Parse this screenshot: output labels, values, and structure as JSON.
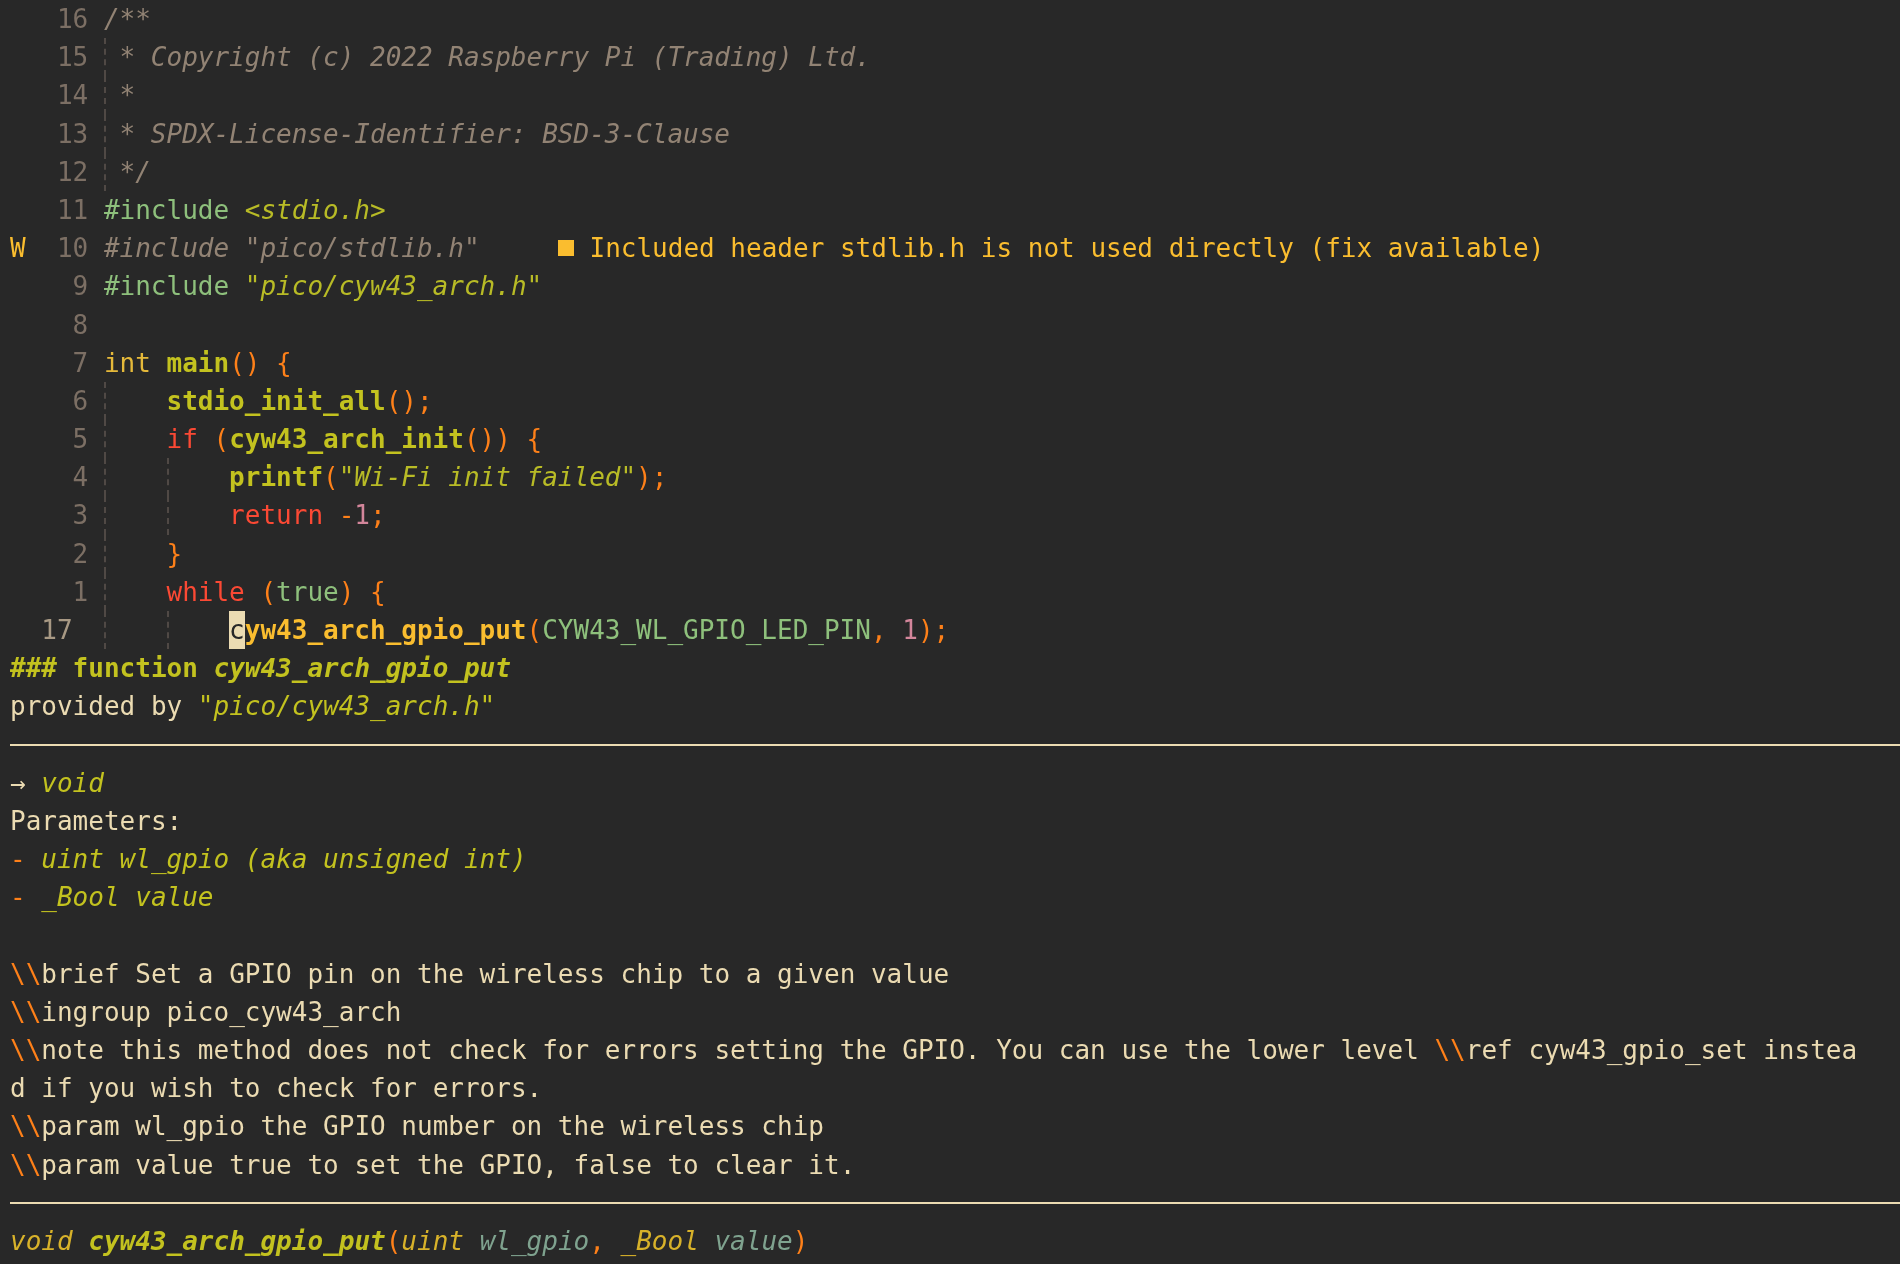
{
  "editor": {
    "lines": [
      {
        "number": "16",
        "current": false,
        "segments": [
          {
            "kind": "comment",
            "text": "/**"
          }
        ]
      },
      {
        "number": "15",
        "current": false,
        "guides": [
          {
            "kind": "narrow"
          }
        ],
        "segments": [
          {
            "kind": "comment",
            "text": "* Copyright (c) 2022 Raspberry Pi (Trading) Ltd."
          }
        ]
      },
      {
        "number": "14",
        "current": false,
        "guides": [
          {
            "kind": "narrow"
          }
        ],
        "segments": [
          {
            "kind": "comment",
            "text": "*"
          }
        ]
      },
      {
        "number": "13",
        "current": false,
        "guides": [
          {
            "kind": "narrow"
          }
        ],
        "segments": [
          {
            "kind": "comment",
            "text": "* SPDX-License-Identifier: BSD-3-Clause"
          }
        ]
      },
      {
        "number": "12",
        "current": false,
        "guides": [
          {
            "kind": "narrow"
          }
        ],
        "segments": [
          {
            "kind": "comment",
            "text": "*/"
          }
        ]
      },
      {
        "number": "11",
        "current": false,
        "segments": [
          {
            "kind": "preproc",
            "text": "#include "
          },
          {
            "kind": "string",
            "text": "<stdio.h>"
          }
        ]
      },
      {
        "sign": "W",
        "number": "10",
        "current": false,
        "segments": [
          {
            "kind": "unused",
            "text": "#include \"pico/stdlib.h\""
          }
        ],
        "diagnostic": {
          "message": "Included header stdlib.h is not used directly (fix available)"
        }
      },
      {
        "number": "9",
        "current": false,
        "segments": [
          {
            "kind": "preproc",
            "text": "#include "
          },
          {
            "kind": "string",
            "text": "\"pico/cyw43_arch.h\""
          }
        ]
      },
      {
        "number": "8",
        "current": false
      },
      {
        "number": "7",
        "current": false,
        "segments": [
          {
            "kind": "type",
            "text": "int "
          },
          {
            "kind": "function",
            "text": "main"
          },
          {
            "kind": "punct",
            "text": "() {"
          }
        ]
      },
      {
        "number": "6",
        "current": false,
        "guides": [
          {
            "kind": "wide"
          }
        ],
        "segments": [
          {
            "kind": "function",
            "text": "stdio_init_all"
          },
          {
            "kind": "punct",
            "text": "();"
          }
        ]
      },
      {
        "number": "5",
        "current": false,
        "guides": [
          {
            "kind": "wide"
          }
        ],
        "segments": [
          {
            "kind": "keyword",
            "text": "if "
          },
          {
            "kind": "punct",
            "text": "("
          },
          {
            "kind": "function",
            "text": "cyw43_arch_init"
          },
          {
            "kind": "punct",
            "text": "()) {"
          }
        ]
      },
      {
        "number": "4",
        "current": false,
        "guides": [
          {
            "kind": "wide"
          },
          {
            "kind": "wide"
          }
        ],
        "segments": [
          {
            "kind": "function",
            "text": "printf"
          },
          {
            "kind": "punct",
            "text": "("
          },
          {
            "kind": "string",
            "text": "\"Wi-Fi init failed\""
          },
          {
            "kind": "punct",
            "text": ");"
          }
        ]
      },
      {
        "number": "3",
        "current": false,
        "guides": [
          {
            "kind": "wide"
          },
          {
            "kind": "wide"
          }
        ],
        "segments": [
          {
            "kind": "keyword",
            "text": "return "
          },
          {
            "kind": "punct",
            "text": "-"
          },
          {
            "kind": "number",
            "text": "1"
          },
          {
            "kind": "punct",
            "text": ";"
          }
        ]
      },
      {
        "number": "2",
        "current": false,
        "guides": [
          {
            "kind": "wide"
          }
        ],
        "segments": [
          {
            "kind": "punct",
            "text": "}"
          }
        ]
      },
      {
        "number": "1",
        "current": false,
        "guides": [
          {
            "kind": "wide"
          }
        ],
        "segments": [
          {
            "kind": "keyword",
            "text": "while "
          },
          {
            "kind": "punct",
            "text": "("
          },
          {
            "kind": "constant",
            "text": "true"
          },
          {
            "kind": "punct",
            "text": ") {"
          }
        ]
      },
      {
        "number": "17",
        "current": true,
        "guides": [
          {
            "kind": "wide"
          },
          {
            "kind": "wide"
          }
        ],
        "segments": [
          {
            "kind": "cursor",
            "text": "c"
          },
          {
            "kind": "call",
            "text": "yw43_arch_gpio_put"
          },
          {
            "kind": "punct",
            "text": "("
          },
          {
            "kind": "constant",
            "text": "CYW43_WL_GPIO_LED_PIN"
          },
          {
            "kind": "punct",
            "text": ", "
          },
          {
            "kind": "number",
            "text": "1"
          },
          {
            "kind": "punct",
            "text": ");"
          }
        ]
      }
    ]
  },
  "hover": {
    "rows": [
      {
        "kind": "text",
        "segments": [
          {
            "kind": "heading",
            "text": "### function "
          },
          {
            "kind": "heading-name",
            "text": "cyw43_arch_gpio_put"
          }
        ]
      },
      {
        "kind": "text",
        "segments": [
          {
            "kind": "plain",
            "text": "provided by "
          },
          {
            "kind": "emph",
            "text": "\"pico/cyw43_arch.h\""
          }
        ]
      },
      {
        "kind": "rule"
      },
      {
        "kind": "text",
        "segments": [
          {
            "kind": "plain",
            "text": "→ "
          },
          {
            "kind": "emph",
            "text": "void"
          }
        ]
      },
      {
        "kind": "text",
        "segments": [
          {
            "kind": "plain",
            "text": "Parameters:"
          }
        ]
      },
      {
        "kind": "text",
        "segments": [
          {
            "kind": "bullet",
            "text": "- "
          },
          {
            "kind": "emph",
            "text": "uint wl_gpio (aka unsigned int)"
          }
        ]
      },
      {
        "kind": "text",
        "segments": [
          {
            "kind": "bullet",
            "text": "- "
          },
          {
            "kind": "emph",
            "text": "_Bool value"
          }
        ]
      },
      {
        "kind": "blank"
      },
      {
        "kind": "text",
        "segments": [
          {
            "kind": "bullet",
            "text": "\\\\"
          },
          {
            "kind": "plain",
            "text": "brief Set a GPIO pin on the wireless chip to a given value"
          }
        ]
      },
      {
        "kind": "text",
        "segments": [
          {
            "kind": "bullet",
            "text": "\\\\"
          },
          {
            "kind": "plain",
            "text": "ingroup pico_cyw43_arch"
          }
        ]
      },
      {
        "kind": "text",
        "segments": [
          {
            "kind": "bullet",
            "text": "\\\\"
          },
          {
            "kind": "plain",
            "text": "note this method does not check for errors setting the GPIO. You can use the lower level "
          },
          {
            "kind": "bullet",
            "text": "\\\\"
          },
          {
            "kind": "plain",
            "text": "ref cyw43_gpio_set instea"
          }
        ]
      },
      {
        "kind": "text",
        "segments": [
          {
            "kind": "plain",
            "text": "d if you wish to check for errors."
          }
        ]
      },
      {
        "kind": "text",
        "segments": [
          {
            "kind": "bullet",
            "text": "\\\\"
          },
          {
            "kind": "plain",
            "text": "param wl_gpio the GPIO number on the wireless chip"
          }
        ]
      },
      {
        "kind": "text",
        "segments": [
          {
            "kind": "bullet",
            "text": "\\\\"
          },
          {
            "kind": "plain",
            "text": "param value true to set the GPIO, false to clear it."
          }
        ]
      },
      {
        "kind": "rule"
      },
      {
        "kind": "text",
        "segments": [
          {
            "kind": "sig-type",
            "text": "void "
          },
          {
            "kind": "heading-name",
            "text": "cyw43_arch_gpio_put"
          },
          {
            "kind": "bullet",
            "text": "("
          },
          {
            "kind": "sig-type",
            "text": "uint "
          },
          {
            "kind": "param",
            "text": "wl_gpio"
          },
          {
            "kind": "bullet",
            "text": ", "
          },
          {
            "kind": "sig-type",
            "text": "_Bool "
          },
          {
            "kind": "param",
            "text": "value"
          },
          {
            "kind": "bullet",
            "text": ")"
          }
        ]
      }
    ]
  }
}
